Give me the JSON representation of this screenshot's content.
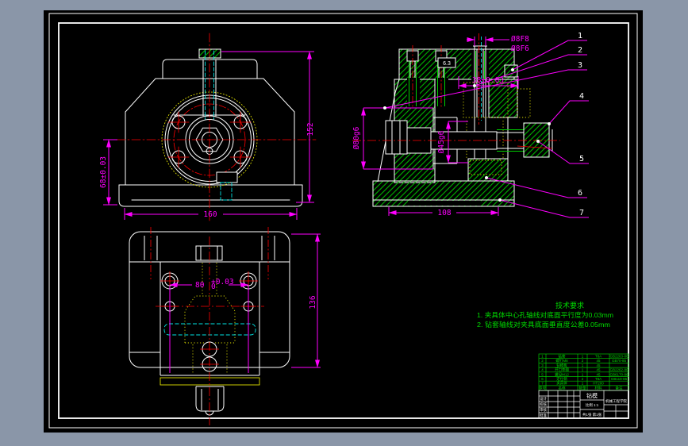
{
  "drawing": {
    "front_view": {
      "dims": {
        "height": "152",
        "center_to_base": "68±0.03",
        "width": "160"
      }
    },
    "bottom_view": {
      "dims": {
        "hole_spacing": "80",
        "tol_upper": "+0.03",
        "tol_lower": "0",
        "height": "136"
      }
    },
    "section_view": {
      "dims": {
        "bushing_fit_top": "Ø8F8",
        "bushing_fit_bottom": "Ø8F6",
        "plate_offset": "38±0.03",
        "boss_dia": "Ø80g6",
        "bore_dia": "Ø45g6",
        "base_width": "108",
        "surface_label": "6.3"
      }
    }
  },
  "balloons": [
    "1",
    "2",
    "3",
    "4",
    "5",
    "6",
    "7"
  ],
  "tech_req": {
    "title": "技术要求",
    "line1": "1. 夹具体中心孔轴线对底面平行度为0.03mm",
    "line2": "2. 钻套轴线对夹具底面垂直度公差0.05mm"
  },
  "parts_list": {
    "header": {
      "no": "序号",
      "name": "名称",
      "qty": "数量",
      "mat": "材料",
      "std": "备注"
    },
    "rows": [
      {
        "no": "1",
        "name": "钻套",
        "qty": "1",
        "mat": "T8A",
        "std": "GB2263-80"
      },
      {
        "no": "2",
        "name": "螺钉M8",
        "qty": "2",
        "mat": "45",
        "std": "GB70-85"
      },
      {
        "no": "3",
        "name": "钻模板",
        "qty": "1",
        "mat": "45",
        "std": ""
      },
      {
        "no": "4",
        "name": "开口垫圈",
        "qty": "1",
        "mat": "45",
        "std": "GB2262-80"
      },
      {
        "no": "5",
        "name": "螺母M12",
        "qty": "1",
        "mat": "45",
        "std": "GB6170-86"
      },
      {
        "no": "6",
        "name": "定位销",
        "qty": "2",
        "mat": "T8A",
        "std": "GB119-86"
      },
      {
        "no": "7",
        "name": "夹具体",
        "qty": "1",
        "mat": "HT200",
        "std": ""
      }
    ]
  },
  "title_block": {
    "title": "钻模",
    "scale": "比例 1:1",
    "sheet": "共1张 第1张",
    "org": "机械工程学院",
    "row1": "设计",
    "row2": "校核",
    "row3": "审核",
    "row4": "批准"
  }
}
